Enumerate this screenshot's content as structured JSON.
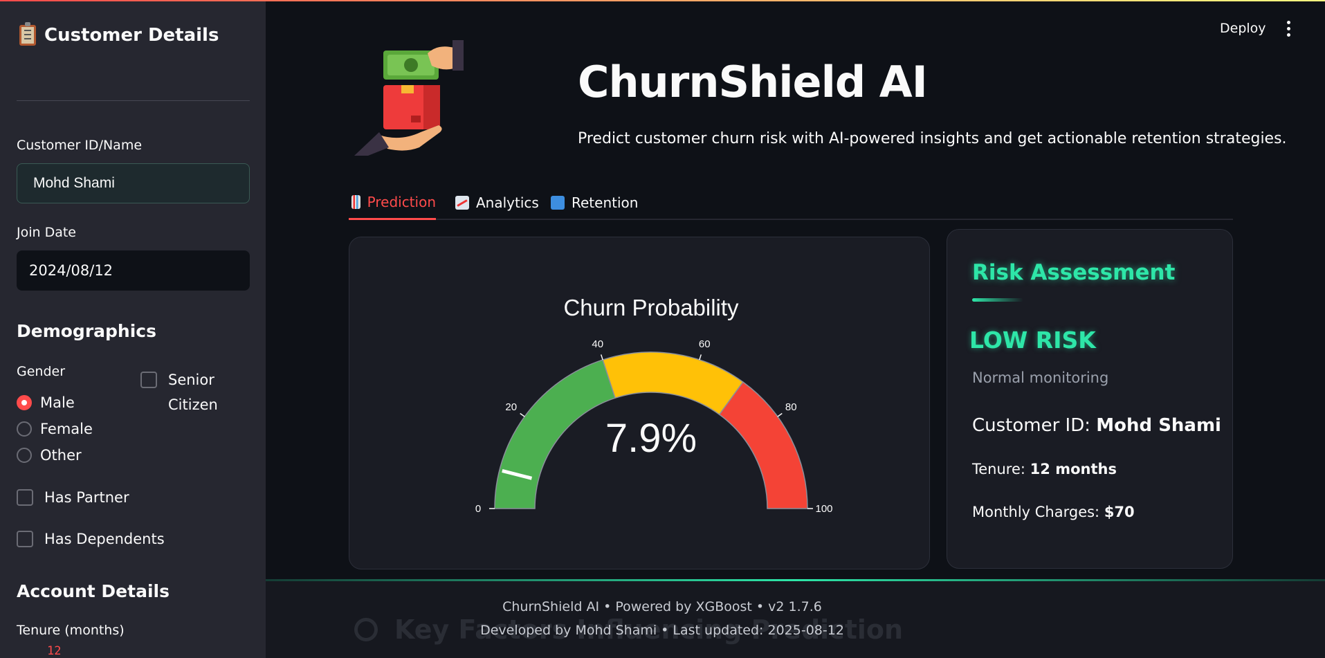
{
  "sidebar": {
    "title": "Customer Details",
    "customer_label": "Customer ID/Name",
    "customer_value": "Mohd Shami",
    "join_label": "Join Date",
    "join_value": "2024/08/12",
    "demographics_heading": "Demographics",
    "gender_label": "Gender",
    "gender_options": [
      "Male",
      "Female",
      "Other"
    ],
    "gender_selected": "Male",
    "senior_label": "Senior Citizen",
    "senior_checked": false,
    "partner_label": "Has Partner",
    "partner_checked": false,
    "dependents_label": "Has Dependents",
    "dependents_checked": false,
    "account_heading": "Account Details",
    "tenure_label": "Tenure (months)",
    "tenure_value": "12"
  },
  "header": {
    "deploy_label": "Deploy",
    "title": "ChurnShield AI",
    "subtitle": "Predict customer churn risk with AI-powered insights and get actionable retention strategies."
  },
  "tabs": [
    {
      "label": "Prediction",
      "icon": "bar-chart-icon",
      "active": true
    },
    {
      "label": "Analytics",
      "icon": "line-chart-icon",
      "active": false
    },
    {
      "label": "Retention",
      "icon": "shield-icon",
      "active": false
    }
  ],
  "chart_data": {
    "type": "gauge",
    "title": "Churn Probability",
    "value": 7.9,
    "value_text": "7.9%",
    "range": [
      0,
      100
    ],
    "ticks": [
      "0",
      "20",
      "40",
      "60",
      "80",
      "100"
    ],
    "bands": [
      {
        "from": 0,
        "to": 40,
        "color": "#4caf50"
      },
      {
        "from": 40,
        "to": 70,
        "color": "#ffc107"
      },
      {
        "from": 70,
        "to": 100,
        "color": "#f44336"
      }
    ]
  },
  "risk": {
    "title": "Risk Assessment",
    "level": "LOW RISK",
    "note": "Normal monitoring",
    "customer_prefix": "Customer ID: ",
    "customer_value": "Mohd Shami",
    "tenure_prefix": "Tenure: ",
    "tenure_value": "12 months",
    "charges_prefix": "Monthly Charges: ",
    "charges_value": "$70",
    "accent_color": "#2ee6a8"
  },
  "footer": {
    "line1": "ChurnShield AI • Powered by XGBoost • v2 1.7.6",
    "line2": "Developed by Mohd Shami • Last updated: 2025-08-12",
    "ghost_heading": "Key Factors Influencing Prediction"
  }
}
